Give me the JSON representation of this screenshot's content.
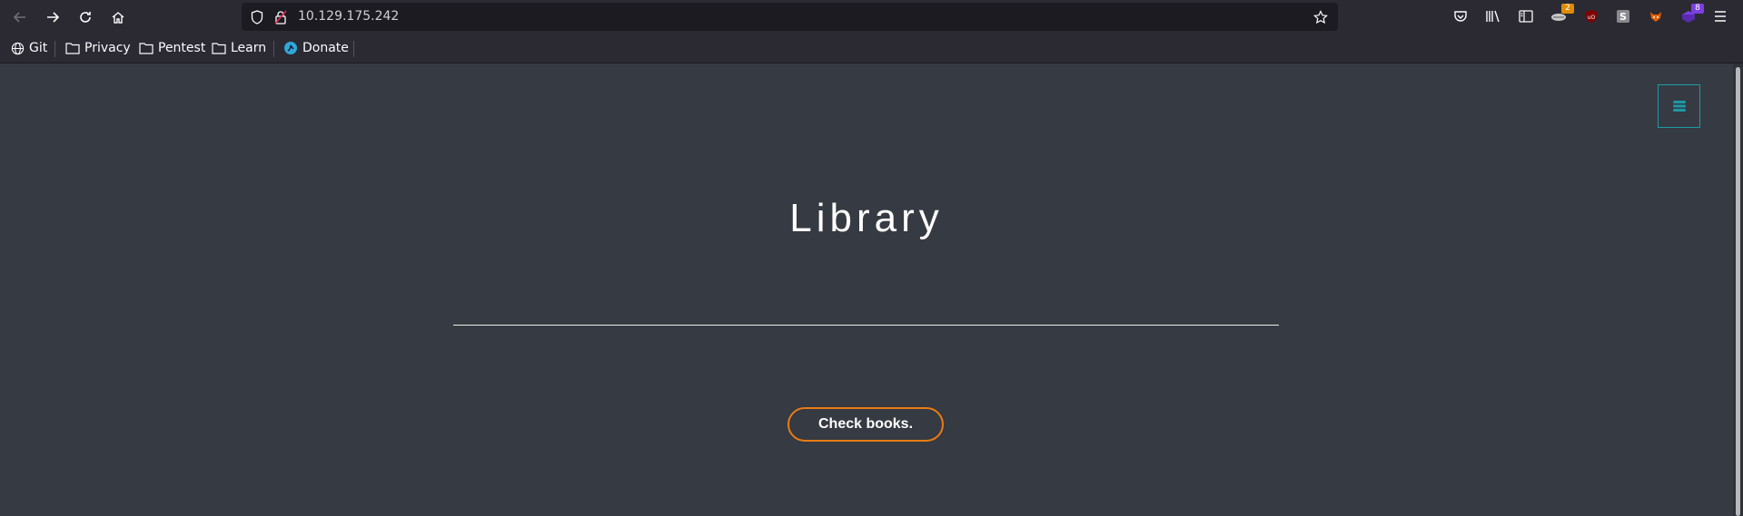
{
  "browser": {
    "url": "10.129.175.242",
    "extensions": {
      "badge_1": "2",
      "badge_2": "8"
    },
    "bookmarks": [
      {
        "label": "Git",
        "icon": "globe-icon"
      },
      {
        "label": "Privacy",
        "icon": "folder-icon"
      },
      {
        "label": "Pentest",
        "icon": "folder-icon"
      },
      {
        "label": "Learn",
        "icon": "folder-icon"
      },
      {
        "label": "Donate",
        "icon": "donate-icon"
      }
    ]
  },
  "page": {
    "title": "Library",
    "cta_label": "Check books.",
    "menu_icon": "hamburger-icon"
  },
  "colors": {
    "page_background": "#363a42",
    "accent_teal": "#1b9aa6",
    "button_border": "#e87c14"
  }
}
